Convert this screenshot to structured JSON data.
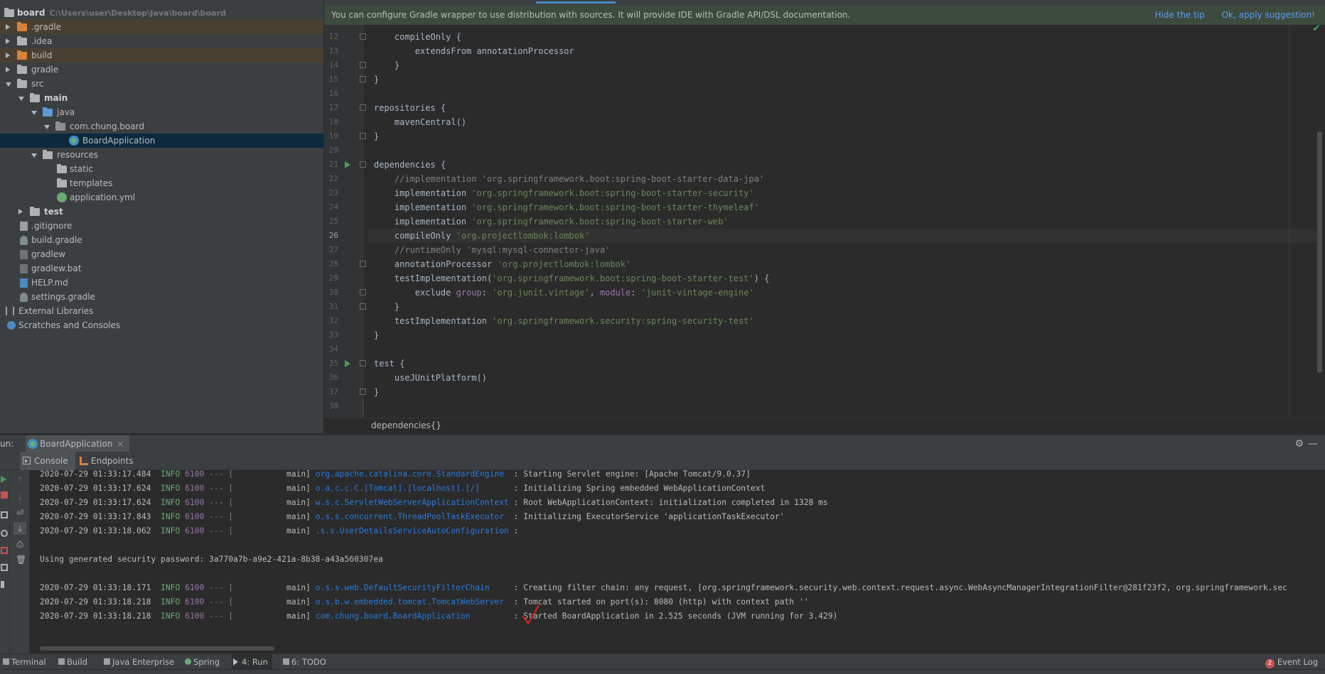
{
  "project": {
    "root_name": "board",
    "root_path": "C:\\Users\\user\\Desktop\\Java\\board\\board",
    "items": [
      {
        "label": ".gradle"
      },
      {
        "label": ".idea"
      },
      {
        "label": "build"
      },
      {
        "label": "gradle"
      },
      {
        "label": "src"
      },
      {
        "label": "main"
      },
      {
        "label": "java"
      },
      {
        "label": "com.chung.board"
      },
      {
        "label": "BoardApplication"
      },
      {
        "label": "resources"
      },
      {
        "label": "static"
      },
      {
        "label": "templates"
      },
      {
        "label": "application.yml"
      },
      {
        "label": "test"
      },
      {
        "label": ".gitignore"
      },
      {
        "label": "build.gradle"
      },
      {
        "label": "gradlew"
      },
      {
        "label": "gradlew.bat"
      },
      {
        "label": "HELP.md"
      },
      {
        "label": "settings.gradle"
      },
      {
        "label": "External Libraries"
      },
      {
        "label": "Scratches and Consoles"
      }
    ]
  },
  "editor": {
    "tip_text": "You can configure Gradle wrapper to use distribution with sources. It will provide IDE with Gradle API/DSL documentation.",
    "tip_hide": "Hide the tip",
    "tip_apply": "Ok, apply suggestion!",
    "breadcrumb": "dependencies{}",
    "line_numbers": [
      "12",
      "13",
      "14",
      "15",
      "16",
      "17",
      "18",
      "19",
      "20",
      "21",
      "22",
      "23",
      "24",
      "25",
      "26",
      "27",
      "28",
      "29",
      "30",
      "31",
      "32",
      "33",
      "34",
      "35",
      "36",
      "37",
      "38"
    ],
    "lines": {
      "l12": "    compileOnly {",
      "l13": "        extendsFrom annotationProcessor",
      "l14": "    }",
      "l15": "}",
      "l17": "repositories {",
      "l18": "    mavenCentral()",
      "l19": "}",
      "l21": "dependencies {",
      "l22": "    //implementation 'org.springframework.boot:spring-boot-starter-data-jpa'",
      "l23_kw": "    implementation ",
      "l23_str": "'org.springframework.boot:spring-boot-starter-security'",
      "l24_kw": "    implementation ",
      "l24_str": "'org.springframework.boot:spring-boot-starter-thymeleaf'",
      "l25_kw": "    implementation ",
      "l25_str": "'org.springframework.boot:spring-boot-starter-web'",
      "l26_kw": "    compileOnly ",
      "l26_str": "'org.projectlombok:lombok'",
      "l27": "    //runtimeOnly 'mysql:mysql-connector-java'",
      "l28_kw": "    annotationProcessor ",
      "l28_str": "'org.projectlombok:lombok'",
      "l29_kw": "    testImplementation(",
      "l29_str": "'org.springframework.boot:spring-boot-starter-test'",
      "l29_end": ") {",
      "l30_kw": "        exclude ",
      "l30_g": "group",
      "l30_sep1": ": ",
      "l30_s1": "'org.junit.vintage'",
      "l30_sep2": ", ",
      "l30_m": "module",
      "l30_sep3": ": ",
      "l30_s2": "'junit-vintage-engine'",
      "l31": "    }",
      "l32_kw": "    testImplementation ",
      "l32_str": "'org.springframework.security:spring-security-test'",
      "l33": "}",
      "l35": "test {",
      "l36": "    useJUnitPlatform()",
      "l37": "}"
    }
  },
  "run": {
    "label": "un:",
    "tab_label": "BoardApplication",
    "sub_console": "Console",
    "sub_endpoints": "Endpoints",
    "logs": [
      {
        "ts": "2020-07-29 01:33:17.484",
        "lvl": "INFO",
        "pid": "6100",
        "thread": "main",
        "cls": "org.apache.catalina.core.StandardEngine  ",
        "msg": ": Starting Servlet engine: [Apache Tomcat/9.0.37]"
      },
      {
        "ts": "2020-07-29 01:33:17.624",
        "lvl": "INFO",
        "pid": "6100",
        "thread": "main",
        "cls": "o.a.c.c.C.[Tomcat].[localhost].[/]       ",
        "msg": ": Initializing Spring embedded WebApplicationContext"
      },
      {
        "ts": "2020-07-29 01:33:17.624",
        "lvl": "INFO",
        "pid": "6100",
        "thread": "main",
        "cls": "w.s.c.ServletWebServerApplicationContext",
        "msg": " : Root WebApplicationContext: initialization completed in 1328 ms"
      },
      {
        "ts": "2020-07-29 01:33:17.843",
        "lvl": "INFO",
        "pid": "6100",
        "thread": "main",
        "cls": "o.s.s.concurrent.ThreadPoolTaskExecutor ",
        "msg": " : Initializing ExecutorService 'applicationTaskExecutor'"
      },
      {
        "ts": "2020-07-29 01:33:18.062",
        "lvl": "INFO",
        "pid": "6100",
        "thread": "main",
        "cls": ".s.s.UserDetailsServiceAutoConfiguration ",
        "msg": ": "
      },
      {
        "ts": "2020-07-29 01:33:18.171",
        "lvl": "INFO",
        "pid": "6100",
        "thread": "main",
        "cls": "o.s.s.web.DefaultSecurityFilterChain     ",
        "msg": ": Creating filter chain: any request, [org.springframework.security.web.context.request.async.WebAsyncManagerIntegrationFilter@281f23f2, org.springframework.sec"
      },
      {
        "ts": "2020-07-29 01:33:18.218",
        "lvl": "INFO",
        "pid": "6100",
        "thread": "main",
        "cls": "o.s.b.w.embedded.tomcat.TomcatWebServer  ",
        "msg": ": Tomcat started on port(s): 8080 (http) with context path ''"
      },
      {
        "ts": "2020-07-29 01:33:18.218",
        "lvl": "INFO",
        "pid": "6100",
        "thread": "main",
        "cls": "com.chung.board.BoardApplication         ",
        "msg": ": Started BoardApplication in 2.525 seconds (JVM running for 3.429)"
      }
    ],
    "password_line": "Using generated security password: 3a770a7b-a9e2-421a-8b38-a43a560307ea"
  },
  "bottom": {
    "terminal": "Terminal",
    "build": "Build",
    "java_enterprise": "Java Enterprise",
    "spring": "Spring",
    "run": "4: Run",
    "todo": "6: TODO",
    "event_log": "Event Log",
    "event_count": "2"
  }
}
